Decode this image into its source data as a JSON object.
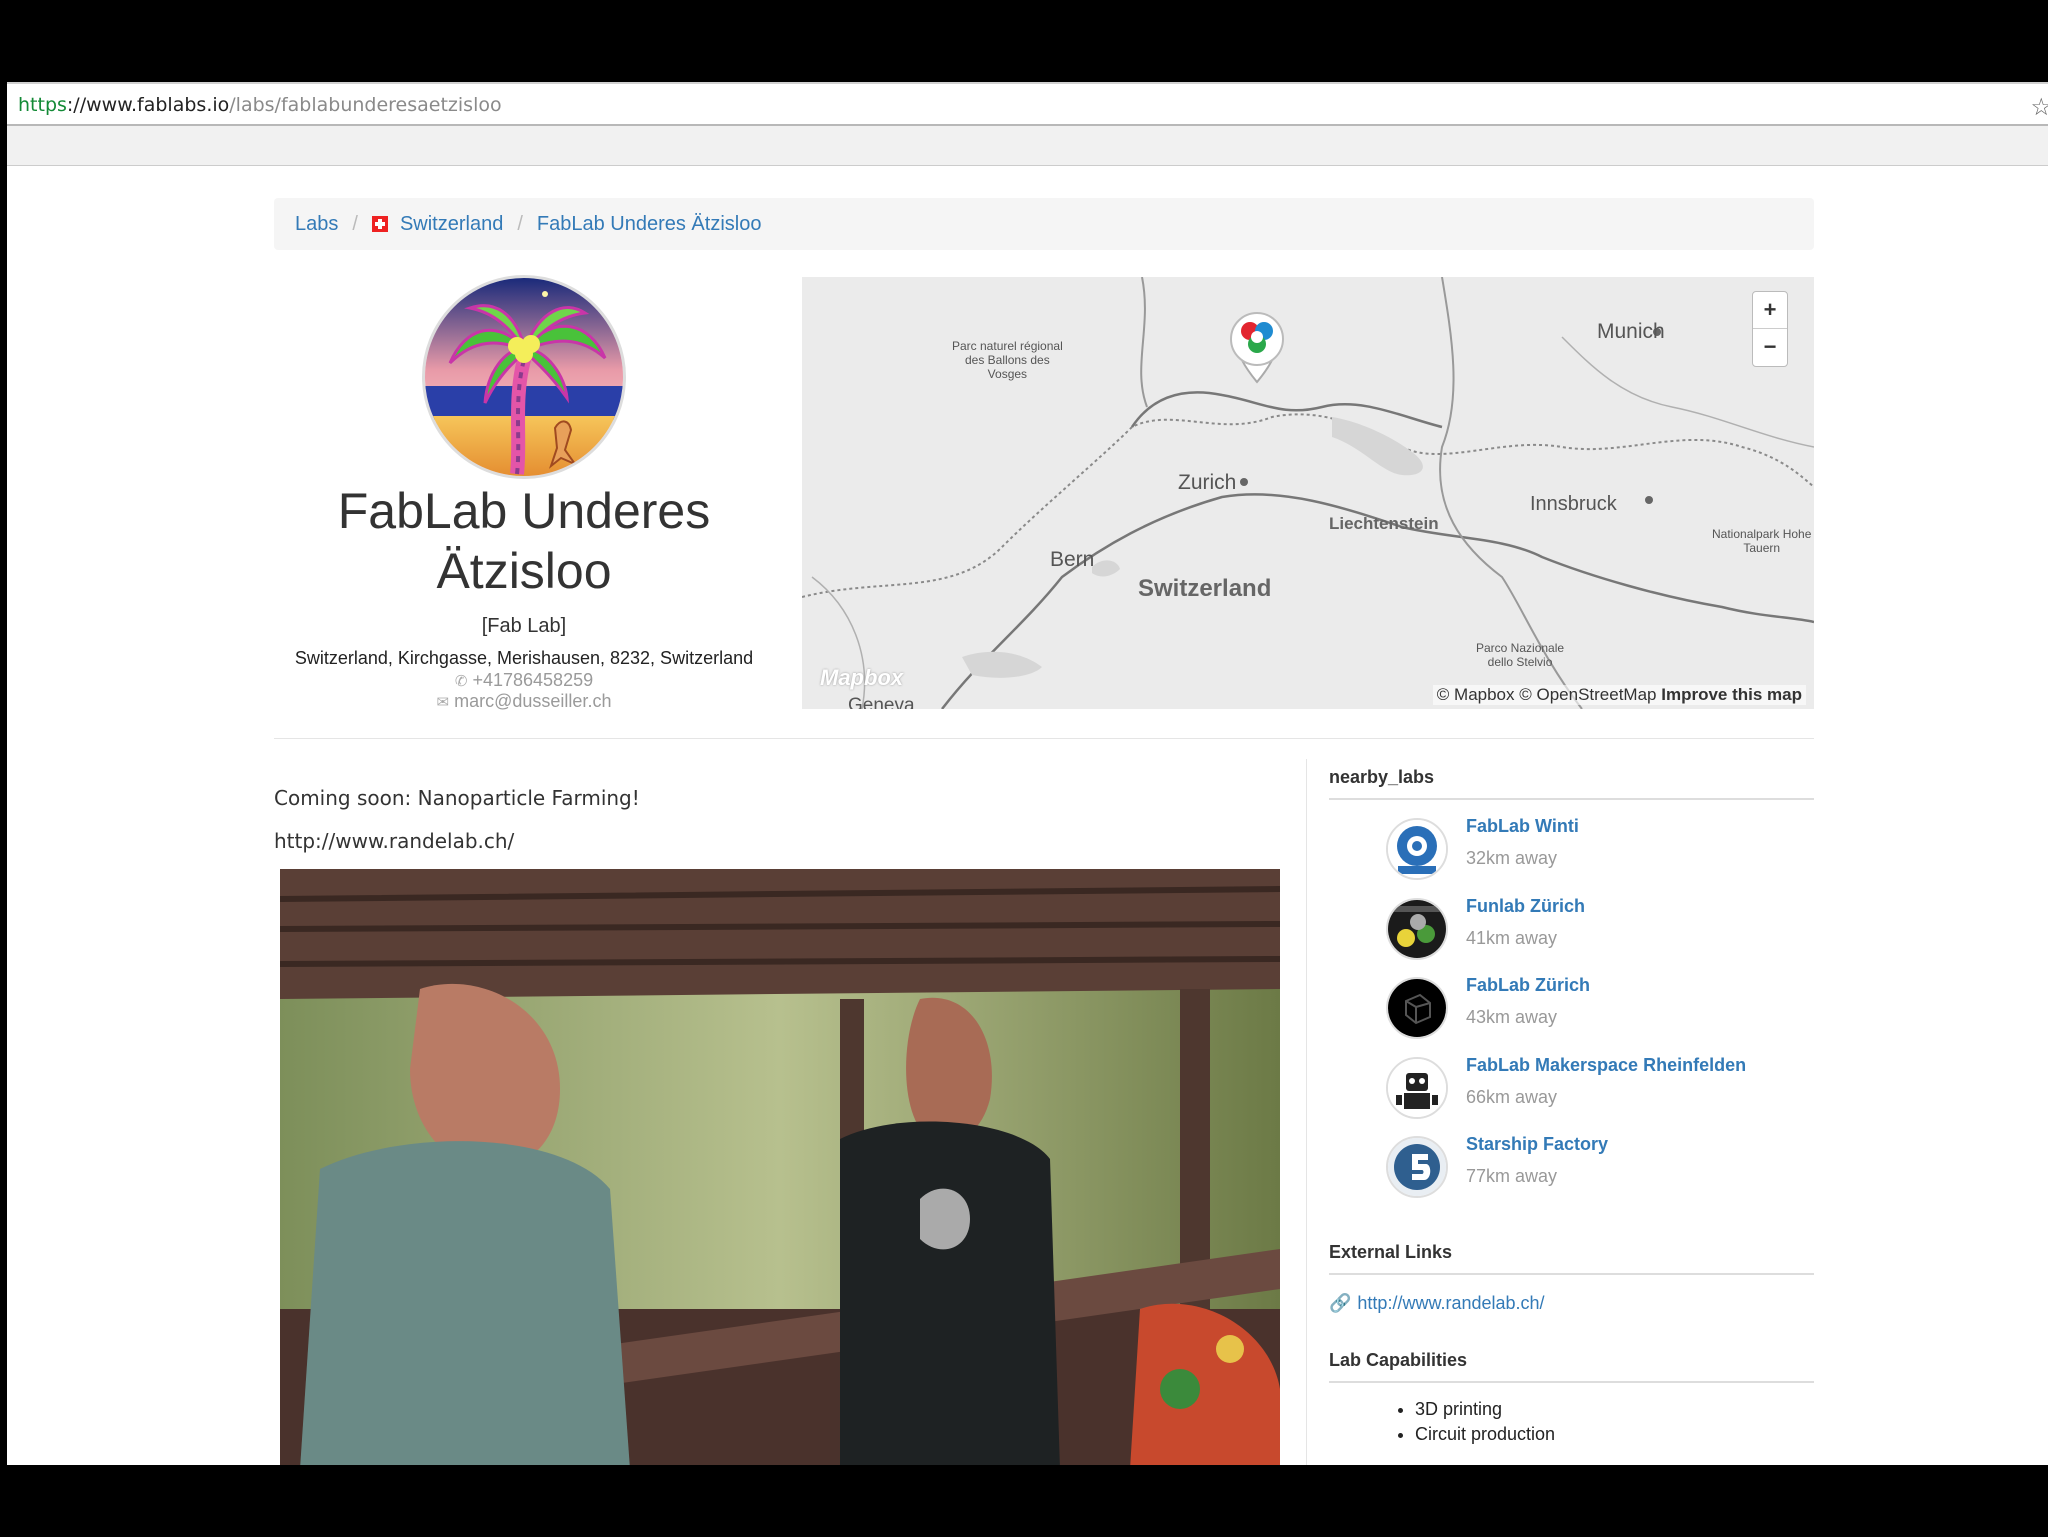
{
  "browser": {
    "url_scheme": "https",
    "url_sep": "://",
    "url_host": "www.fablabs.io",
    "url_path": "/labs/fablabunderesaetzisloo",
    "star_icon": "☆"
  },
  "breadcrumb": {
    "items": [
      "Labs",
      "Switzerland",
      "FabLab Underes Ätzisloo"
    ],
    "separator": "/"
  },
  "lab": {
    "title": "FabLab Underes Ätzisloo",
    "kind": "[Fab Lab]",
    "address": "Switzerland, Kirchgasse, Merishausen, 8232, Switzerland",
    "phone": "+41786458259",
    "email": "marc@dusseiller.ch"
  },
  "map": {
    "zoom_in": "+",
    "zoom_out": "−",
    "attribution_text": "© Mapbox © OpenStreetMap",
    "attribution_link": "Improve this map",
    "logo_text": "Mapbox",
    "labels": {
      "munich": "Munich",
      "zurich": "Zurich",
      "bern": "Bern",
      "switzerland": "Switzerland",
      "liechtenstein": "Liechtenstein",
      "innsbruck": "Innsbruck",
      "geneva": "Geneva",
      "ballons_line1": "Parc naturel régional",
      "ballons_line2": "des Ballons des",
      "ballons_line3": "Vosges",
      "stelvio_line1": "Parco Nazionale",
      "stelvio_line2": "dello Stelvio",
      "tauern_line1": "Nationalpark Hohe",
      "tauern_line2": "Tauern"
    }
  },
  "description": {
    "line1": "Coming soon: Nanoparticle Farming!",
    "line2": "http://www.randelab.ch/"
  },
  "sidebar": {
    "nearby_heading": "nearby_labs",
    "nearby": [
      {
        "name": "FabLab Winti",
        "distance": "32km away"
      },
      {
        "name": "Funlab Zürich",
        "distance": "41km away"
      },
      {
        "name": "FabLab Zürich",
        "distance": "43km away"
      },
      {
        "name": "FabLab Makerspace Rheinfelden",
        "distance": "66km away"
      },
      {
        "name": "Starship Factory",
        "distance": "77km away"
      }
    ],
    "external_heading": "External Links",
    "external_link": "http://www.randelab.ch/",
    "capabilities_heading": "Lab Capabilities",
    "capabilities": [
      "3D printing",
      "Circuit production"
    ]
  },
  "icons": {
    "phone": "phone-icon",
    "email": "envelope-icon",
    "link": "link-icon"
  }
}
